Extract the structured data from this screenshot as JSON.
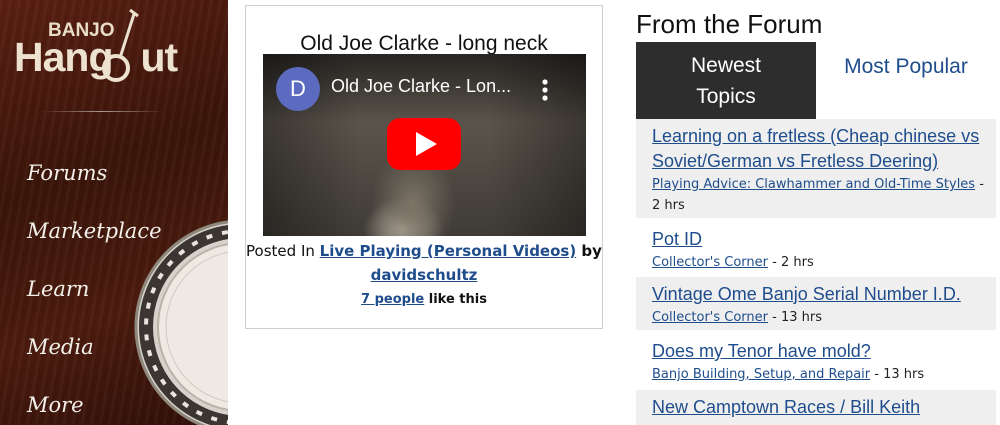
{
  "sidebar": {
    "logo": {
      "small": "BANJO",
      "big": "Hang",
      "big_end": "ut"
    },
    "nav": [
      {
        "label": "Forums"
      },
      {
        "label": "Marketplace"
      },
      {
        "label": "Learn"
      },
      {
        "label": "Media"
      },
      {
        "label": "More"
      }
    ]
  },
  "video_card": {
    "title": "Old Joe Clarke - long neck",
    "video": {
      "channel_initial": "D",
      "title": "Old Joe Clarke - Lon...",
      "menu_icon": "kebab-icon",
      "play_icon": "youtube-play-icon"
    },
    "posted_prefix": "Posted In ",
    "category": "Live Playing (Personal Videos)",
    "by": " by",
    "author": "davidschultz",
    "likes_link": "7 people",
    "likes_suffix": " like this"
  },
  "forum": {
    "heading": "From the Forum",
    "tabs": [
      {
        "label": "Newest Topics",
        "active": true
      },
      {
        "label": "Most Popular",
        "active": false
      }
    ],
    "topics": [
      {
        "title": "Learning on a fretless (Cheap chinese vs Soviet/German vs Fretless Deering)",
        "category": "Playing Advice: Clawhammer and Old-Time Styles",
        "age": " - 2 hrs"
      },
      {
        "title": "Pot ID",
        "category": "Collector's Corner",
        "age": " - 2 hrs"
      },
      {
        "title": "Vintage Ome Banjo Serial Number I.D.",
        "category": "Collector's Corner",
        "age": " - 13 hrs"
      },
      {
        "title": "Does my Tenor have mold?",
        "category": "Banjo Building, Setup, and Repair",
        "age": " - 13 hrs"
      },
      {
        "title": "New Camptown Races / Bill Keith",
        "category": "",
        "age": ""
      }
    ]
  },
  "colors": {
    "link": "#1f4d8c",
    "active_tab": "#2d2d2d",
    "row_shade": "#efefef",
    "youtube_red": "#ff0000"
  }
}
